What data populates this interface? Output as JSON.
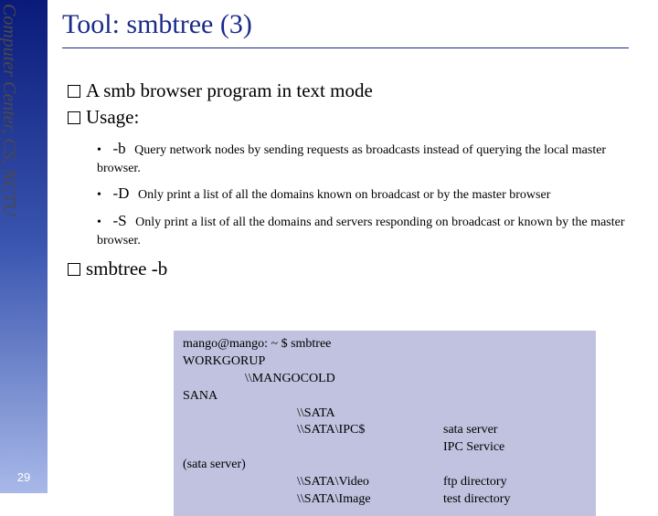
{
  "side_label": "Computer Center, CS, NCTU",
  "page_number": "29",
  "title": "Tool: smbtree (3)",
  "bullets": {
    "b1": "A smb browser program in text mode",
    "b2": "Usage:",
    "b3": "smbtree -b"
  },
  "opts": {
    "o1_flag": "-b",
    "o1_desc": "Query network nodes by sending requests as broadcasts instead of querying the local master browser.",
    "o2_flag": "-D",
    "o2_desc": "Only print a list of all the domains known on broadcast or by the master browser",
    "o3_flag": "-S",
    "o3_desc": "Only print a list of all the domains and servers responding on broadcast or known by the master browser."
  },
  "terminal": {
    "l1": "mango@mango: ~ $ smbtree",
    "l2": "WORKGORUP",
    "l3": "\\\\MANGOCOLD",
    "l4": "SANA",
    "l5": "\\\\SATA",
    "l6a": "\\\\SATA\\IPC$",
    "l6b": "sata server",
    "l6c": "IPC Service",
    "l7": "(sata server)",
    "l8a": "\\\\SATA\\Video",
    "l8b": "ftp directory",
    "l9a": "\\\\SATA\\Image",
    "l9b": "test directory"
  }
}
